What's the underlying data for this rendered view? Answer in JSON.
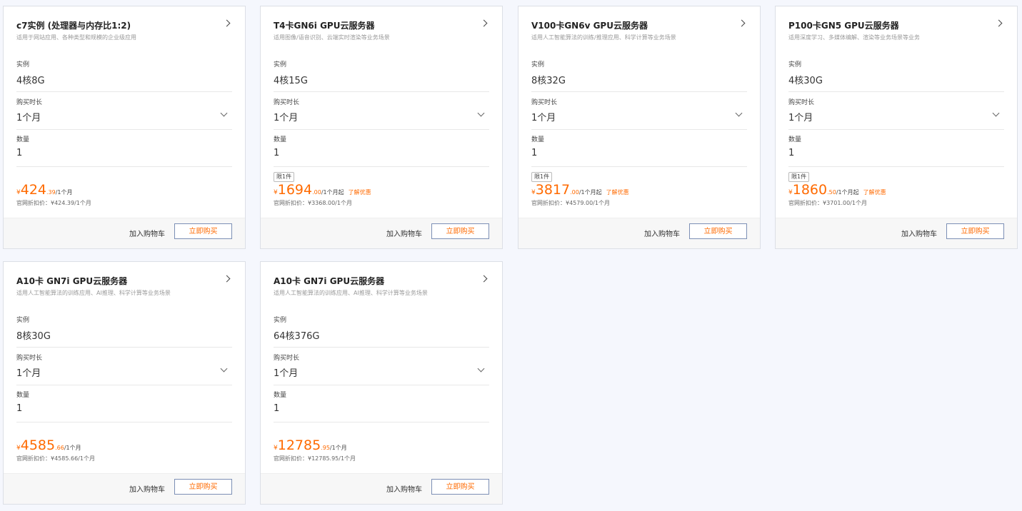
{
  "labels": {
    "instance": "实例",
    "duration": "购买时长",
    "quantity": "数量",
    "add_to_cart": "加入购物车",
    "buy_now": "立即购买",
    "promo_link": "了解优惠",
    "limit_badge": "限1件"
  },
  "cards": [
    {
      "title": "c7实例 (处理器与内存比1:2)",
      "desc": "适用于网站应用、各种类型和规模的企业级应用",
      "instance": "4核8G",
      "duration": "1个月",
      "quantity": "1",
      "price_yen": "¥",
      "price_int": "424",
      "price_dec": ".39",
      "price_unit": "/1个月",
      "official": "官网折扣价：¥424.39/1个月",
      "has_badge": false,
      "has_promo": false
    },
    {
      "title": "T4卡GN6i GPU云服务器",
      "desc": "适用图像/语音识别、云端实时渲染等业务场景",
      "instance": "4核15G",
      "duration": "1个月",
      "quantity": "1",
      "price_yen": "¥",
      "price_int": "1694",
      "price_dec": ".00",
      "price_unit": "/1个月起",
      "official": "官网折扣价：¥3368.00/1个月",
      "has_badge": true,
      "has_promo": true
    },
    {
      "title": "V100卡GN6v GPU云服务器",
      "desc": "适用人工智能算法的训练/推理应用、科学计算等业务场景",
      "instance": "8核32G",
      "duration": "1个月",
      "quantity": "1",
      "price_yen": "¥",
      "price_int": "3817",
      "price_dec": ".00",
      "price_unit": "/1个月起",
      "official": "官网折扣价：¥4579.00/1个月",
      "has_badge": true,
      "has_promo": true
    },
    {
      "title": "P100卡GN5 GPU云服务器",
      "desc": "适用深度学习、多媒体编解、渲染等业务场景等业务",
      "instance": "4核30G",
      "duration": "1个月",
      "quantity": "1",
      "price_yen": "¥",
      "price_int": "1860",
      "price_dec": ".50",
      "price_unit": "/1个月起",
      "official": "官网折扣价：¥3701.00/1个月",
      "has_badge": true,
      "has_promo": true
    },
    {
      "title": "A10卡 GN7i GPU云服务器",
      "desc": "适用人工智能算法的训练应用、AI推理、科学计算等业务场景",
      "instance": "8核30G",
      "duration": "1个月",
      "quantity": "1",
      "price_yen": "¥",
      "price_int": "4585",
      "price_dec": ".66",
      "price_unit": "/1个月",
      "official": "官网折扣价：¥4585.66/1个月",
      "has_badge": false,
      "has_promo": false
    },
    {
      "title": "A10卡 GN7i GPU云服务器",
      "desc": "适用人工智能算法的训练应用、AI推理、科学计算等业务场景",
      "instance": "64核376G",
      "duration": "1个月",
      "quantity": "1",
      "price_yen": "¥",
      "price_int": "12785",
      "price_dec": ".95",
      "price_unit": "/1个月",
      "official": "官网折扣价：¥12785.95/1个月",
      "has_badge": false,
      "has_promo": false
    }
  ],
  "colors": {
    "accent": "#ff6a00",
    "button_border": "#7c8fb5",
    "page_bg": "#f5f7fd"
  }
}
